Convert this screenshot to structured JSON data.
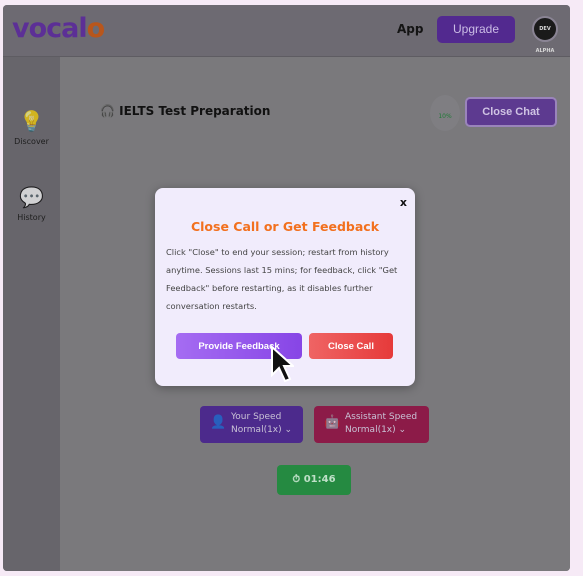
{
  "header": {
    "logo": "vocal",
    "logo_o": "o",
    "app_link": "App",
    "upgrade_label": "Upgrade",
    "avatar_text": "DEV ALPHA"
  },
  "sidebar": {
    "items": [
      {
        "label": "Discover",
        "icon": "lightbulb-icon"
      },
      {
        "label": "History",
        "icon": "chat-bubbles-icon"
      }
    ]
  },
  "main": {
    "title": "IELTS Test Preparation",
    "progress_text": "10%",
    "progress": 0.1,
    "close_chat_label": "Close Chat",
    "your_speed": {
      "label": "Your Speed",
      "value": "Normal(1x)"
    },
    "assistant_speed": {
      "label": "Assistant Speed",
      "value": "Normal(1x)"
    },
    "timer": "01:46"
  },
  "modal": {
    "close": "x",
    "title": "Close Call or Get Feedback",
    "body": "Click \"Close\" to end your session; restart from history anytime. Sessions last 15 mins; for feedback, click \"Get Feedback\" before restarting, as it disables further conversation restarts.",
    "feedback_label": "Provide Feedback",
    "close_call_label": "Close Call"
  },
  "colors": {
    "brand": "#7c3fd8",
    "accent": "#f2701e",
    "danger": "#e63a3a",
    "success": "#33c15c"
  }
}
